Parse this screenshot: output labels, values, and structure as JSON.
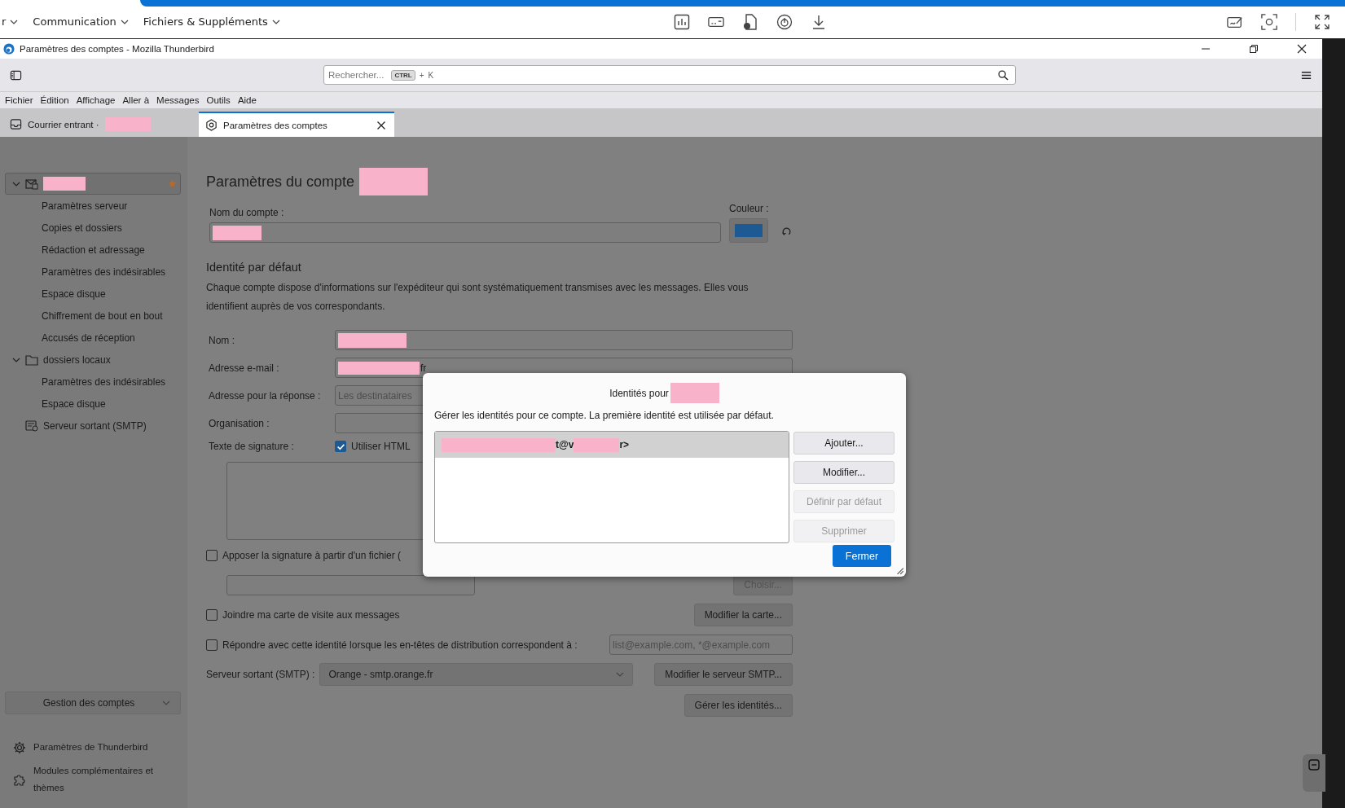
{
  "top_toolbar": {
    "menus": [
      {
        "label": "r"
      },
      {
        "label": "Communication"
      },
      {
        "label": "Fichiers & Suppléments"
      }
    ]
  },
  "window": {
    "title": "Paramètres des comptes - Mozilla Thunderbird"
  },
  "search": {
    "placeholder": "Rechercher...",
    "keys": [
      "CTRL",
      "+",
      "K"
    ]
  },
  "menu_bar": [
    "Fichier",
    "Édition",
    "Affichage",
    "Aller à",
    "Messages",
    "Outils",
    "Aide"
  ],
  "tabs": [
    {
      "label": "Courrier entrant ·",
      "kind": "inbox",
      "selected": false,
      "closable": false
    },
    {
      "label": "Paramètres des comptes",
      "kind": "settings",
      "selected": true,
      "closable": true
    }
  ],
  "sidebar": {
    "tree": [
      {
        "kind": "account",
        "selected": true,
        "expanded": true,
        "children": [
          {
            "label": "Paramètres serveur"
          },
          {
            "label": "Copies et dossiers"
          },
          {
            "label": "Rédaction et adressage"
          },
          {
            "label": "Paramètres des indésirables"
          },
          {
            "label": "Espace disque"
          },
          {
            "label": "Chiffrement de bout en bout"
          },
          {
            "label": "Accusés de réception"
          }
        ]
      },
      {
        "kind": "folder",
        "label": "dossiers locaux",
        "selected": false,
        "expanded": true,
        "children": [
          {
            "label": "Paramètres des indésirables"
          },
          {
            "label": "Espace disque"
          }
        ]
      },
      {
        "kind": "smtp",
        "label": "Serveur sortant (SMTP)",
        "selected": false
      }
    ],
    "manage_button": "Gestion des comptes",
    "footer": [
      {
        "kind": "settings",
        "label": "Paramètres de Thunderbird"
      },
      {
        "kind": "addons",
        "label": "Modules complémentaires et thèmes"
      }
    ]
  },
  "page": {
    "heading": "Paramètres du compte",
    "account_name_label": "Nom du compte :",
    "color_label": "Couleur :",
    "identity_heading": "Identité par défaut",
    "identity_description": "Chaque compte dispose d'informations sur l'expéditeur qui sont systématiquement transmises avec les messages. Elles vous identifient auprès de vos correspondants.",
    "fields": [
      {
        "label": "Nom :"
      },
      {
        "label": "Adresse e-mail :",
        "value": "fr"
      },
      {
        "label": "Adresse pour la réponse :",
        "placeholder": "Les destinataires"
      },
      {
        "label": "Organisation :"
      }
    ],
    "signature_label": "Texte de signature :",
    "use_html": {
      "label": "Utiliser HTML",
      "checked": true
    },
    "signature_file": {
      "label": "Apposer la signature à partir d'un fichier (",
      "checked": false,
      "button": "Choisir..."
    },
    "vcard": {
      "label": "Joindre ma carte de visite aux messages",
      "checked": false,
      "button": "Modifier la carte..."
    },
    "reply_match": {
      "label": "Répondre avec cette identité lorsque les en-têtes de distribution correspondent à :",
      "checked": false,
      "placeholder": "list@example.com, *@example.com"
    },
    "smtp": {
      "label": "Serveur sortant (SMTP) :",
      "value": "Orange - smtp.orange.fr",
      "button": "Modifier le serveur SMTP..."
    },
    "manage_identities": "Gérer les identités..."
  },
  "dialog": {
    "title": "Identités pour",
    "description": "Gérer les identités pour ce compte. La première identité est utilisée par défaut.",
    "identities": [
      {
        "fragments": [
          "t@v",
          "r>"
        ],
        "selected": true
      }
    ],
    "buttons": [
      {
        "label": "Ajouter...",
        "disabled": false
      },
      {
        "label": "Modifier...",
        "disabled": false
      },
      {
        "label": "Définir par défaut",
        "disabled": true
      },
      {
        "label": "Supprimer",
        "disabled": true
      }
    ],
    "close": "Fermer"
  }
}
